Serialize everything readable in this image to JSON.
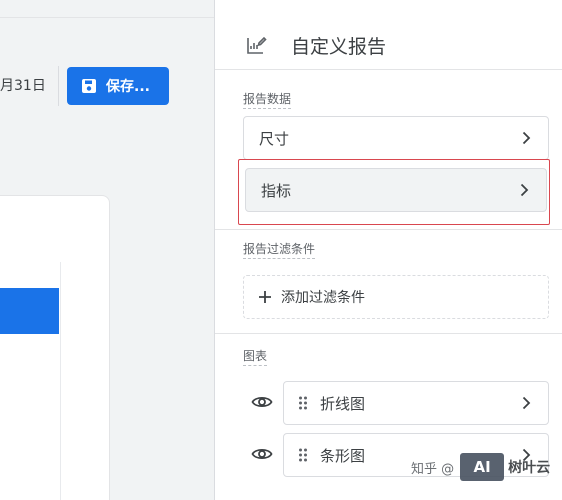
{
  "toolbar": {
    "date_partial": "月31日",
    "save_label": "保存..."
  },
  "panel": {
    "title": "自定义报告",
    "report_data_label": "报告数据",
    "dimensions_label": "尺寸",
    "metrics_label": "指标",
    "filters_label": "报告过滤条件",
    "add_filter_label": "添加过滤条件",
    "charts_label": "图表",
    "charts": [
      {
        "label": "折线图",
        "visible": true
      },
      {
        "label": "条形图",
        "visible": true
      }
    ]
  },
  "watermark": {
    "prefix": "知乎 @",
    "logo_text": "AI",
    "name": "树叶云"
  },
  "colors": {
    "accent": "#1a73e8",
    "highlight_border": "#d9474f",
    "panel_bg": "#ffffff",
    "page_bg": "#f1f3f4"
  }
}
